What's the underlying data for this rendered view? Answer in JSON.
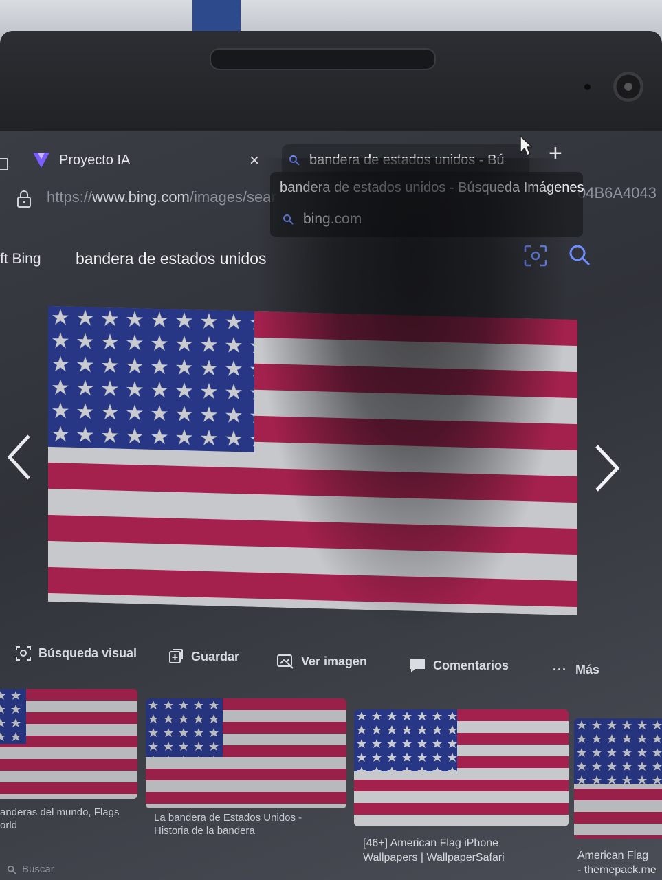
{
  "tabs": [
    {
      "title": "Proyecto IA",
      "close_glyph": "×"
    },
    {
      "title": "bandera de estados unidos - Bú"
    }
  ],
  "new_tab_glyph": "+",
  "address": {
    "prefix": "https://",
    "host": "www.bing.com",
    "path": "/images/sear",
    "tail": "04B6A4043"
  },
  "tooltip": {
    "title": "bandera de estados unidos - Búsqueda Imágenes",
    "site": "bing.com"
  },
  "bing": {
    "brand": "ft Bing",
    "query": "bandera de estados unidos"
  },
  "actions": [
    {
      "label": "Búsqueda visual",
      "icon": "visual-search-icon"
    },
    {
      "label": "Guardar",
      "icon": "save-icon"
    },
    {
      "label": "Ver imagen",
      "icon": "view-image-icon"
    },
    {
      "label": "Comentarios",
      "icon": "comment-icon"
    },
    {
      "label": "Más",
      "icon": "more-icon",
      "glyph": "···"
    }
  ],
  "related": [
    {
      "caption_line1": "anderas del mundo, Flags",
      "caption_line2": "orld"
    },
    {
      "caption_line1": "La bandera de Estados Unidos -",
      "caption_line2": "Historia de la bandera"
    },
    {
      "caption_line1": "[46+] American Flag iPhone",
      "caption_line2": "Wallpapers | WallpaperSafari"
    },
    {
      "caption_line1": "American Flag",
      "caption_line2": "- themepack.me"
    }
  ],
  "bottom_search": "Buscar",
  "colors": {
    "flag_red": "#c4245a",
    "flag_white": "#eef0f4",
    "flag_blue": "#2b3f9e"
  }
}
